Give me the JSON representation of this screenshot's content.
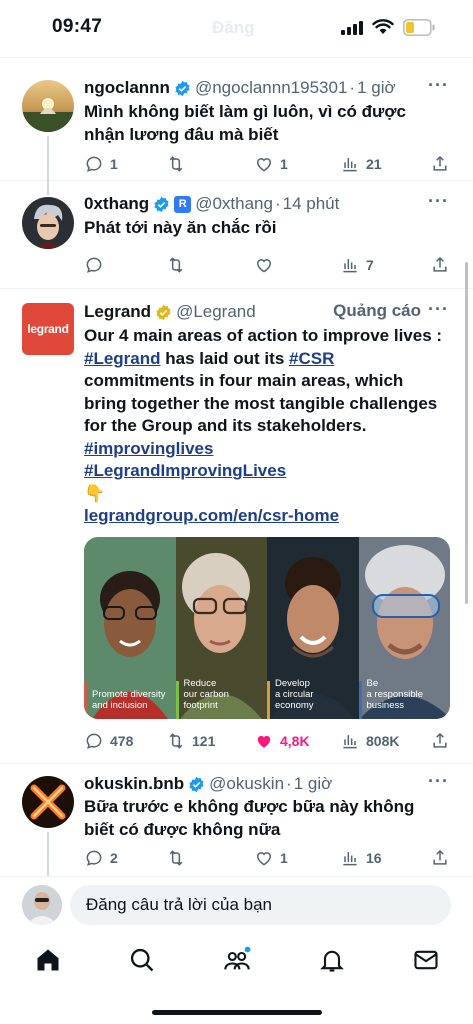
{
  "status_bar": {
    "time": "09:47",
    "ghost_title": "Đăng"
  },
  "tweets": [
    {
      "name": "ngoclannn",
      "handle": "@ngoclannn195301",
      "time": "1 giờ",
      "text": "Mình không biết làm gì luôn, vì có được nhận lương đâu mà biết",
      "replies": "1",
      "retweets": "",
      "likes": "1",
      "views": "21"
    },
    {
      "name": "0xthang",
      "handle": "@0xthang",
      "time": "14 phút",
      "text": "Phát tới này ăn chắc rồi",
      "replies": "",
      "retweets": "",
      "likes": "",
      "views": "7"
    },
    {
      "name": "okuskin.bnb",
      "handle": "@okuskin",
      "time": "1 giờ",
      "text": "Bữa trước e không được bữa này không biết có được không nữa",
      "replies": "2",
      "retweets": "",
      "likes": "1",
      "views": "16"
    }
  ],
  "ad": {
    "logo_text": "legrand",
    "name": "Legrand",
    "handle": "@Legrand",
    "label": "Quảng cáo",
    "text_1": "Our 4 main areas of action to improve lives : ",
    "tag_1": "#Legrand",
    "text_2": " has laid out its ",
    "tag_2": "#CSR",
    "text_3": " commitments in four main areas, which bring together the most tangible challenges for the Group and its stakeholders. ",
    "tag_3": "#improvinglives",
    "tag_4": "#LegrandImprovingLives",
    "emoji": "👇",
    "link": "legrandgroup.com/en/csr-home",
    "panels": [
      {
        "caption": "Promote diversity\nand inclusion",
        "color": "#c9604c"
      },
      {
        "caption": "Reduce\nour carbon\nfootprint",
        "color": "#7cc04b"
      },
      {
        "caption": "Develop\na circular\neconomy",
        "color": "#d99b3b"
      },
      {
        "caption": "Be\na responsible\nbusiness",
        "color": "#3d6fb6"
      }
    ],
    "replies": "478",
    "retweets": "121",
    "likes": "4,8K",
    "views": "808K"
  },
  "reply_bar": {
    "placeholder": "Đăng câu trả lời của bạn"
  },
  "colors": {
    "accent": "#1d9bf0",
    "like": "#f91880",
    "muted": "#536471"
  }
}
